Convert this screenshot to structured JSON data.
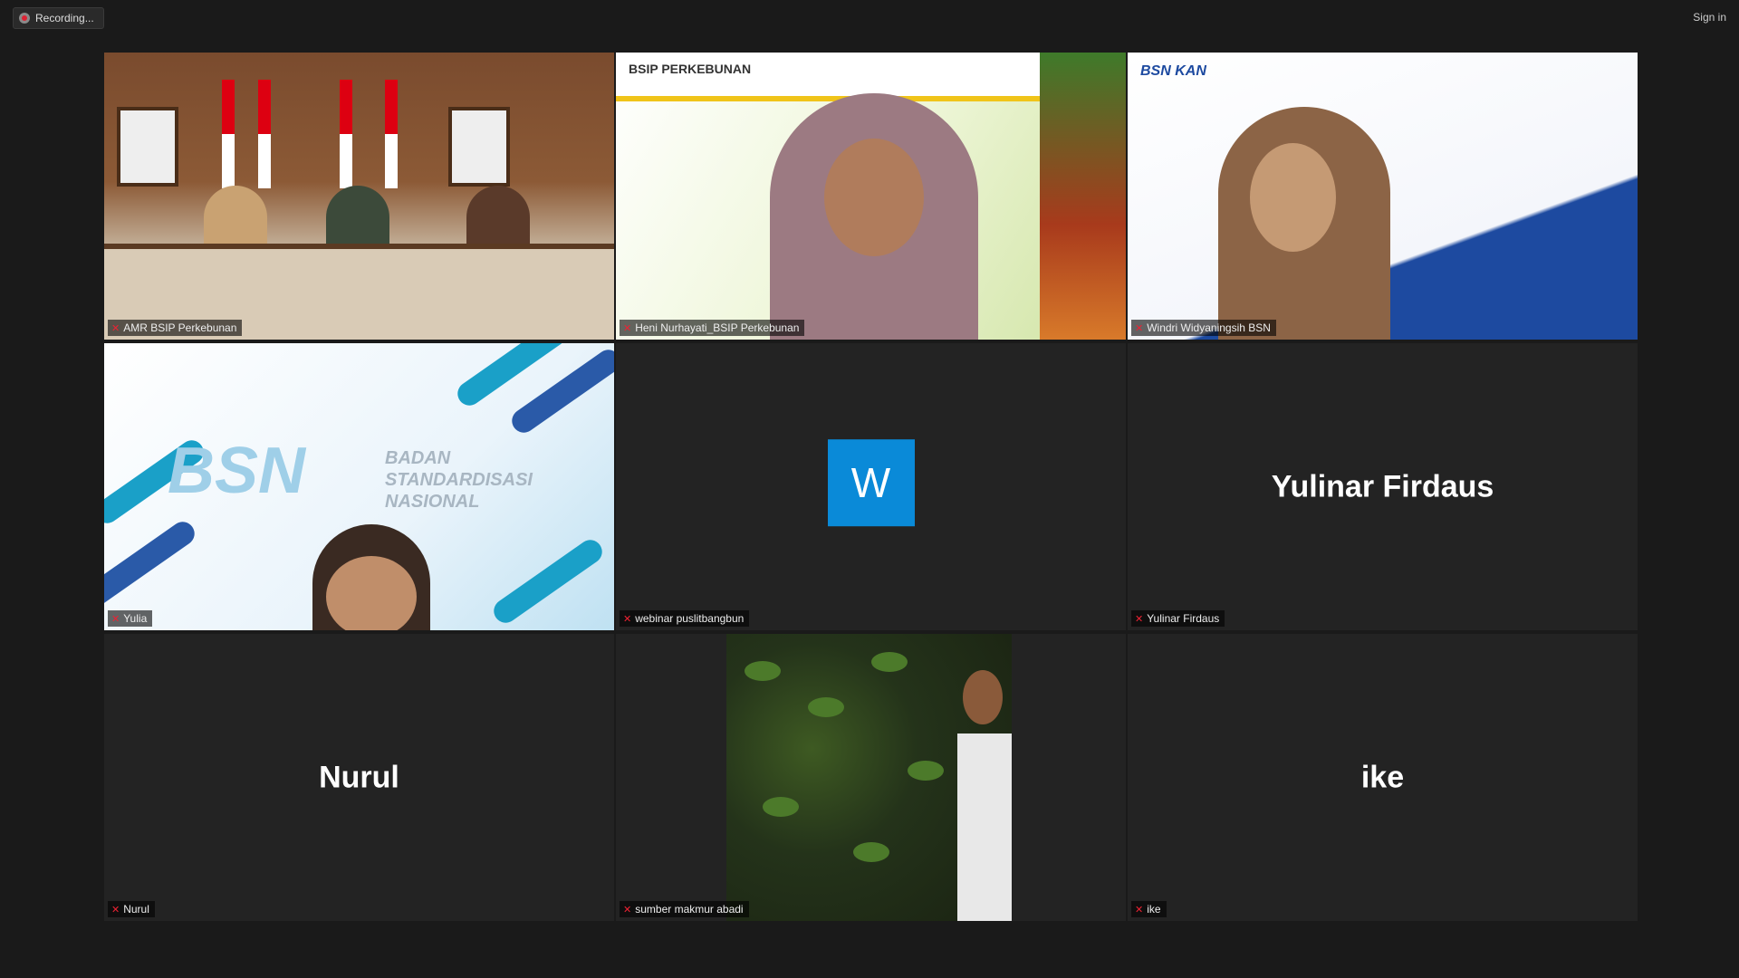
{
  "topbar": {
    "recording_label": "Recording...",
    "signin_label": "Sign in"
  },
  "tiles": [
    {
      "type": "video",
      "name": "AMR BSIP Perkebunan",
      "active": true
    },
    {
      "type": "video",
      "name": "Heni Nurhayati_BSIP Perkebunan",
      "slide_header": "BSIP PERKEBUNAN"
    },
    {
      "type": "video",
      "name": "Windri Widyaningsih BSN",
      "slide_logo": "BSN  KAN"
    },
    {
      "type": "video",
      "name": "Yulia",
      "slide_logo": "BSN",
      "slide_title_lines": [
        "BADAN",
        "STANDARDISASI",
        "NASIONAL"
      ]
    },
    {
      "type": "avatar",
      "name": "webinar puslitbangbun",
      "avatar_letter": "W",
      "avatar_color": "#0a8ad8"
    },
    {
      "type": "name",
      "name": "Yulinar Firdaus",
      "display_name": "Yulinar Firdaus"
    },
    {
      "type": "name",
      "name": "Nurul",
      "display_name": "Nurul"
    },
    {
      "type": "video",
      "name": "sumber makmur abadi"
    },
    {
      "type": "name",
      "name": "ike",
      "display_name": "ike"
    }
  ],
  "icons": {
    "recording": "recording-dot-icon",
    "muted": "mic-muted-icon"
  }
}
